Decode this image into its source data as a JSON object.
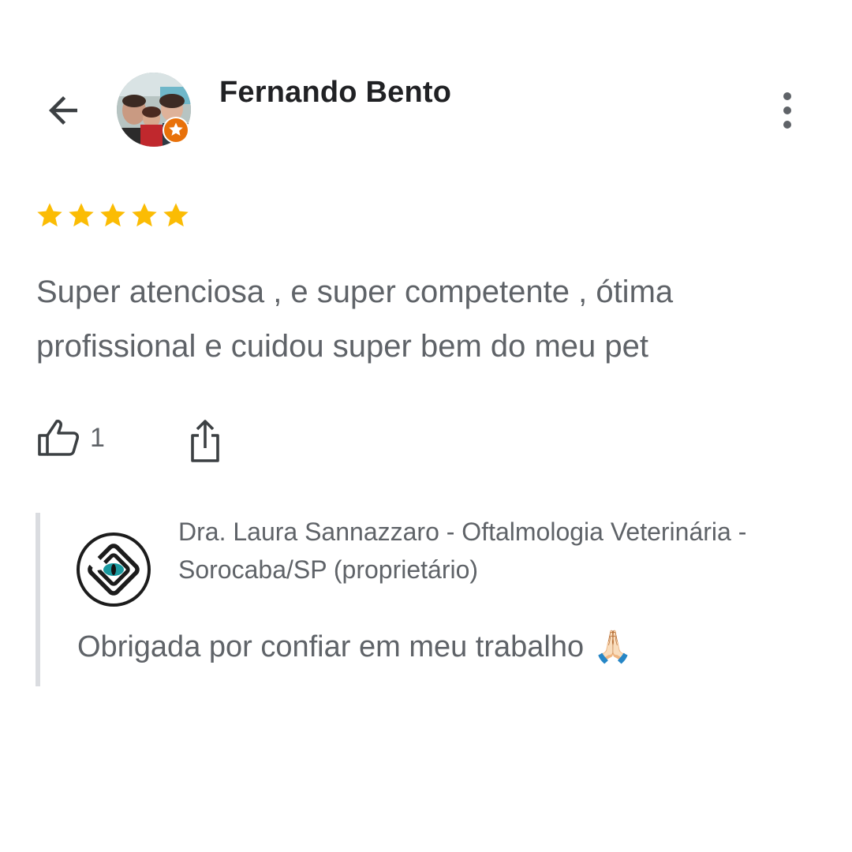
{
  "review": {
    "reviewer_name": "Fernando Bento",
    "rating": 5,
    "text": "Super atenciosa , e super competente , ótima profissional e cuidou super bem do meu pet",
    "like_count": "1"
  },
  "owner_reply": {
    "owner_name": "Dra. Laura Sannazzaro - Oftalmologia Veterinária - Sorocaba/SP (proprietário)",
    "text": "Obrigada por confiar em meu trabalho",
    "emoji": "🙏🏻"
  },
  "colors": {
    "star": "#fbbc04",
    "badge": "#e8710a",
    "text_primary": "#202124",
    "text_secondary": "#5f6368",
    "logo_teal": "#1a9aa0"
  },
  "icons": {
    "back": "arrow-back-icon",
    "more": "more-vert-icon",
    "like": "thumb-up-icon",
    "share": "share-icon",
    "badge": "local-guide-star-icon",
    "logo": "eye-logo-icon"
  }
}
